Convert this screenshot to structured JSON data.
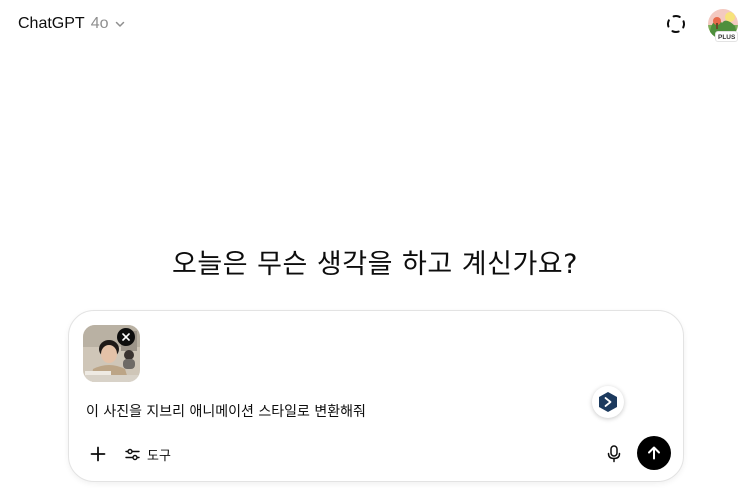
{
  "header": {
    "model_name": "ChatGPT",
    "model_version": "4o",
    "plan_badge": "PLUS",
    "icons": {
      "model_dropdown": "chevron-down-icon",
      "temporary_chat": "dashed-circle-icon",
      "avatar": "user-avatar"
    }
  },
  "main": {
    "headline": "오늘은 무슨 생각을 하고 계신가요?"
  },
  "composer": {
    "attachment": {
      "type": "image",
      "remove_icon": "close-icon"
    },
    "prompt_text": "이 사진을 지브리 애니메이션 스타일로 변환해줘",
    "add_icon": "plus-icon",
    "tools_icon": "sliders-icon",
    "tools_label": "도구",
    "mic_icon": "microphone-icon",
    "send_icon": "arrow-up-icon",
    "extension_icon": "extension-badge-icon"
  },
  "colors": {
    "text": "#0d0d0d",
    "muted": "#8f8f8f",
    "border": "#e3e3e3",
    "send_bg": "#000000",
    "extension": "#1c3a5e"
  }
}
